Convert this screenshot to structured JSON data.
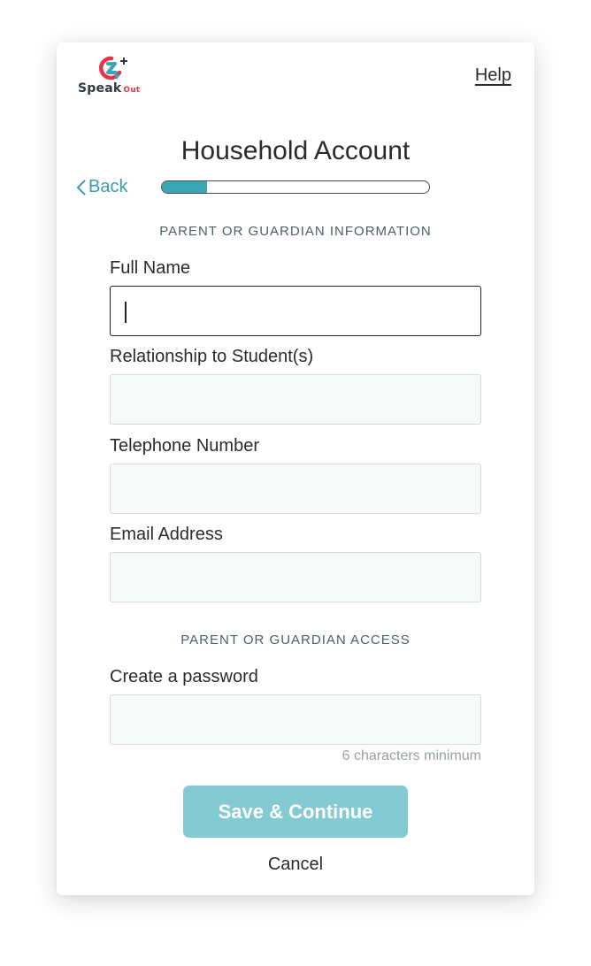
{
  "brand": {
    "logo_name": "Speak",
    "logo_suffix": "Out",
    "accent": "#e8334a",
    "teal": "#3aa6b5"
  },
  "header": {
    "help_label": "Help"
  },
  "page": {
    "title": "Household Account",
    "back_label": "Back",
    "progress_fraction": 0.17
  },
  "sections": {
    "info_title": "PARENT OR GUARDIAN INFORMATION",
    "access_title": "PARENT OR GUARDIAN ACCESS"
  },
  "fields": {
    "full_name": {
      "label": "Full Name",
      "value": ""
    },
    "relationship": {
      "label": "Relationship to Student(s)",
      "value": ""
    },
    "telephone": {
      "label": "Telephone Number",
      "value": ""
    },
    "email": {
      "label": "Email Address",
      "value": ""
    },
    "password": {
      "label": "Create a password",
      "value": "",
      "hint": "6 characters minimum"
    }
  },
  "actions": {
    "save_label": "Save & Continue",
    "cancel_label": "Cancel"
  }
}
